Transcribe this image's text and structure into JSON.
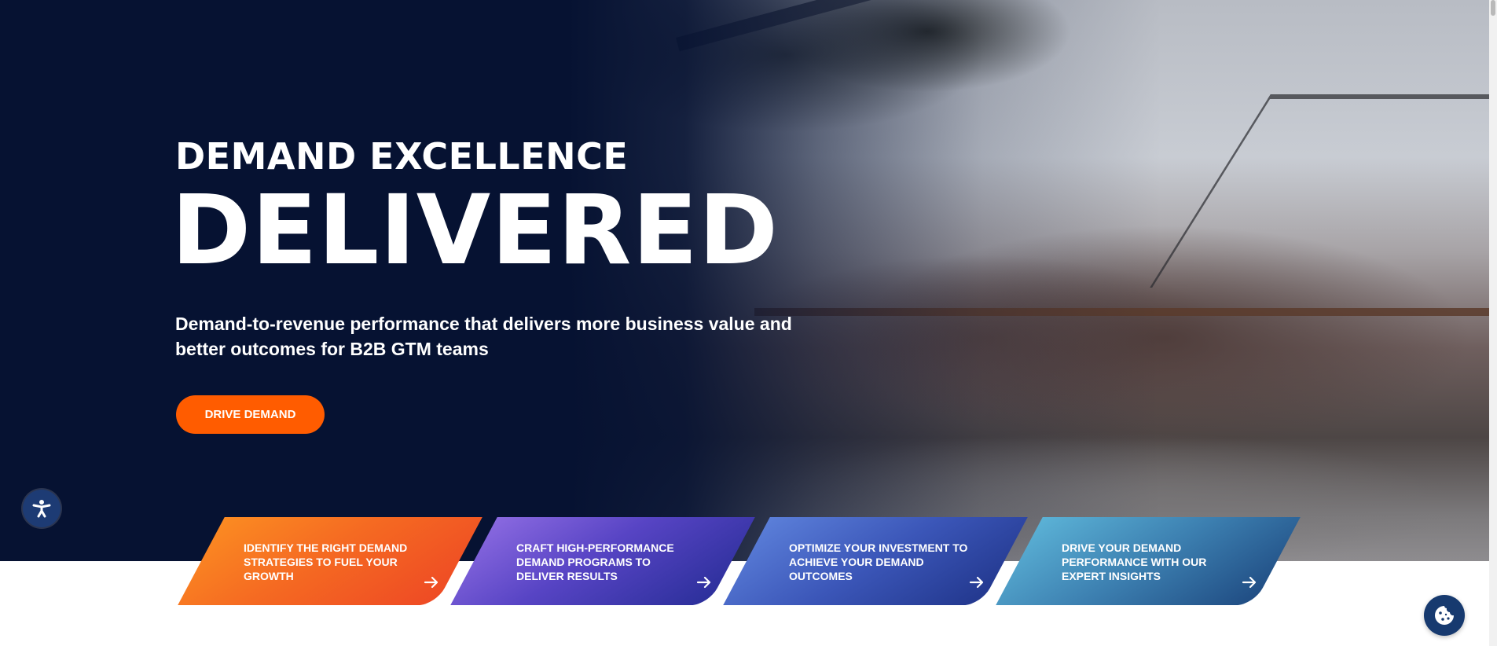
{
  "hero": {
    "eyebrow": "DEMAND EXCELLENCE",
    "headline": "DELIVERED",
    "subhead": "Demand-to-revenue performance that delivers more business value and better outcomes for B2B GTM teams",
    "cta_label": "DRIVE DEMAND"
  },
  "cards": [
    {
      "label": "IDENTIFY THE RIGHT DEMAND STRATEGIES TO FUEL YOUR GROWTH"
    },
    {
      "label": "CRAFT HIGH-PERFORMANCE DEMAND PROGRAMS TO DELIVER RESULTS"
    },
    {
      "label": "OPTIMIZE YOUR INVESTMENT TO ACHIEVE YOUR DEMAND OUTCOMES"
    },
    {
      "label": "DRIVE YOUR DEMAND PERFORMANCE WITH OUR EXPERT INSIGHTS"
    }
  ],
  "icons": {
    "accessibility": "accessibility-icon",
    "arrow": "arrow-right-icon",
    "cookie": "cookie-icon"
  },
  "colors": {
    "navy": "#061232",
    "cta_orange": "#ff5c00",
    "card_1": "#f56a22",
    "card_2": "#5744c4",
    "card_3": "#3b56b8",
    "card_4": "#3c7fb0"
  }
}
